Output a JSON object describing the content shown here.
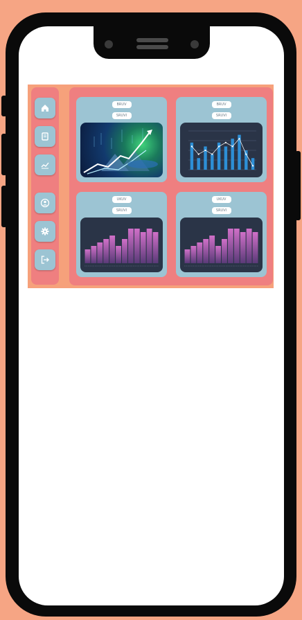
{
  "colors": {
    "page_bg": "#f6a584",
    "panel": "#ef7f80",
    "card": "#9cc4d3",
    "chart_bg": "#2a3447",
    "bar_blue": "#2d8fd6",
    "bar_purple": "#b65fb4"
  },
  "sidebar": {
    "items": [
      {
        "icon": "home-icon"
      },
      {
        "icon": "document-icon"
      },
      {
        "icon": "trend-chart-icon"
      },
      {
        "icon": "user-icon"
      },
      {
        "icon": "gear-icon"
      },
      {
        "icon": "logout-icon"
      }
    ]
  },
  "cards": [
    {
      "label": "BRUV",
      "sublabel": "SRUVI",
      "media": "trading-graph-image"
    },
    {
      "label": "BRUV",
      "sublabel": "SRUVI",
      "media": "bar-line-chart"
    },
    {
      "label": "UKUV",
      "sublabel": "SRUVI",
      "media": "purple-bar-chart"
    },
    {
      "label": "UKUV",
      "sublabel": "SRUVI",
      "media": "purple-bar-chart"
    }
  ],
  "chart_data": [
    {
      "type": "bar",
      "values": [
        7,
        3,
        6,
        4,
        7,
        6,
        8,
        9,
        5,
        3
      ],
      "line_values": [
        6,
        4,
        5,
        4,
        6,
        7,
        6,
        8,
        4,
        1
      ],
      "ylim": [
        0,
        10
      ],
      "grid": true
    },
    {
      "type": "bar",
      "values": [
        4,
        5,
        6,
        7,
        8,
        5,
        7,
        10,
        10,
        9,
        10,
        9
      ],
      "ylim": [
        0,
        12
      ],
      "grid": false
    },
    {
      "type": "bar",
      "values": [
        4,
        5,
        6,
        7,
        8,
        5,
        7,
        10,
        10,
        9,
        10,
        9
      ],
      "ylim": [
        0,
        12
      ],
      "grid": false
    }
  ]
}
